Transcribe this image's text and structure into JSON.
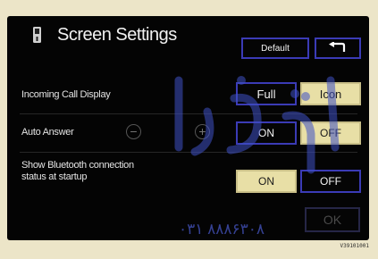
{
  "header": {
    "title": "Screen Settings",
    "icon": "phone-settings-icon",
    "default_label": "Default",
    "back_icon": "back-arrow-icon"
  },
  "rows": {
    "incoming_call": {
      "label": "Incoming Call Display",
      "option_full": "Full",
      "option_icon": "Icon",
      "selected": "Icon"
    },
    "auto_answer": {
      "label": "Auto Answer",
      "minus_icon": "minus-icon",
      "plus_icon": "plus-icon",
      "option_on": "ON",
      "option_off": "OFF",
      "selected": "OFF"
    },
    "bluetooth_status": {
      "label_line1": "Show Bluetooth connection",
      "label_line2": "status at startup",
      "option_on": "ON",
      "option_off": "OFF",
      "selected": "ON"
    }
  },
  "footer": {
    "ok_label": "OK"
  },
  "colors": {
    "background": "#040404",
    "button_border": "#3b3bb6",
    "selected_fill": "#e8dfa6",
    "watermark": "#4a5bd0"
  },
  "overlay": {
    "watermark_digits": "۰۳۱ ۸۸۸۶۳۰۸",
    "corner_code": "V39101001"
  }
}
